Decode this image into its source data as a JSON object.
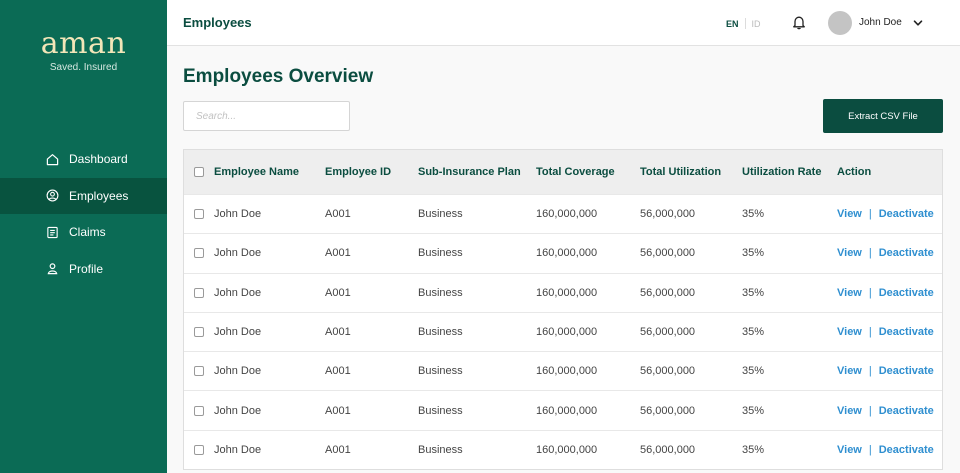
{
  "brand": {
    "logo": "aman",
    "tagline": "Saved. Insured"
  },
  "sidebar": {
    "items": [
      {
        "label": "Dashboard",
        "icon": "home-icon",
        "active": false
      },
      {
        "label": "Employees",
        "icon": "user-circle-icon",
        "active": true
      },
      {
        "label": "Claims",
        "icon": "document-icon",
        "active": false
      },
      {
        "label": "Profile",
        "icon": "person-icon",
        "active": false
      }
    ]
  },
  "header": {
    "title": "Employees",
    "lang_en": "EN",
    "lang_id": "ID",
    "user_name": "John Doe"
  },
  "main": {
    "title": "Employees Overview",
    "search_placeholder": "Search...",
    "export_label": "Extract CSV File"
  },
  "table": {
    "columns": [
      "Employee Name",
      "Employee ID",
      "Sub-Insurance Plan",
      "Total Coverage",
      "Total Utilization",
      "Utilization Rate",
      "Action"
    ],
    "rows": [
      {
        "name": "John Doe",
        "id": "A001",
        "plan": "Business",
        "coverage": "160,000,000",
        "utilization": "56,000,000",
        "rate": "35%",
        "view": "View",
        "sep": "|",
        "deactivate": "Deactivate"
      },
      {
        "name": "John Doe",
        "id": "A001",
        "plan": "Business",
        "coverage": "160,000,000",
        "utilization": "56,000,000",
        "rate": "35%",
        "view": "View",
        "sep": "|",
        "deactivate": "Deactivate"
      },
      {
        "name": "John Doe",
        "id": "A001",
        "plan": "Business",
        "coverage": "160,000,000",
        "utilization": "56,000,000",
        "rate": "35%",
        "view": "View",
        "sep": "|",
        "deactivate": "Deactivate"
      },
      {
        "name": "John Doe",
        "id": "A001",
        "plan": "Business",
        "coverage": "160,000,000",
        "utilization": "56,000,000",
        "rate": "35%",
        "view": "View",
        "sep": "|",
        "deactivate": "Deactivate"
      },
      {
        "name": "John Doe",
        "id": "A001",
        "plan": "Business",
        "coverage": "160,000,000",
        "utilization": "56,000,000",
        "rate": "35%",
        "view": "View",
        "sep": "|",
        "deactivate": "Deactivate"
      },
      {
        "name": "John Doe",
        "id": "A001",
        "plan": "Business",
        "coverage": "160,000,000",
        "utilization": "56,000,000",
        "rate": "35%",
        "view": "View",
        "sep": "|",
        "deactivate": "Deactivate"
      },
      {
        "name": "John Doe",
        "id": "A001",
        "plan": "Business",
        "coverage": "160,000,000",
        "utilization": "56,000,000",
        "rate": "35%",
        "view": "View",
        "sep": "|",
        "deactivate": "Deactivate"
      }
    ]
  },
  "colors": {
    "sidebar": "#0b6b55",
    "sidebar_active": "#08533f",
    "primary": "#0b4d40",
    "link": "#2f8fd0",
    "logo": "#f2e6b8"
  }
}
